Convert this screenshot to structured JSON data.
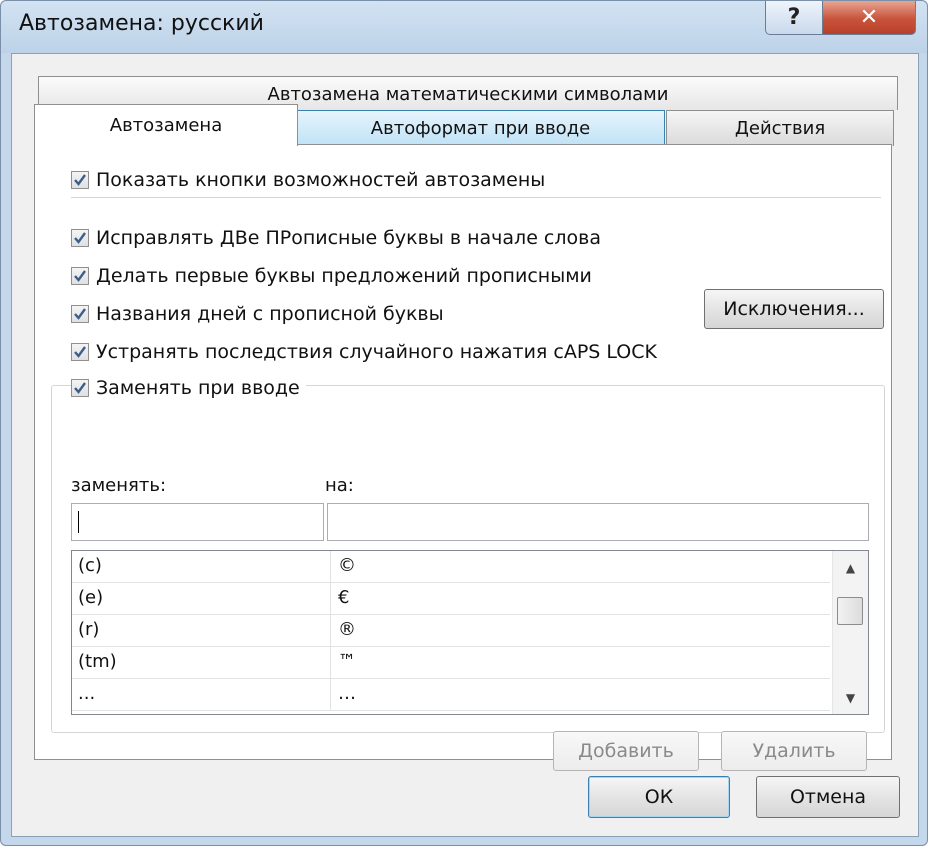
{
  "window": {
    "title": "Автозамена: русский",
    "help_label": "?",
    "close_label": "✕"
  },
  "tabs": {
    "math": "Автозамена математическими символами",
    "autocorrect": "Автозамена",
    "autoformat": "Автоформат при вводе",
    "actions": "Действия"
  },
  "options": {
    "show_buttons": "Показать кнопки возможностей автозамены",
    "two_initial_caps": "Исправлять ДВе ПРописные буквы в начале слова",
    "capitalize_sentences": "Делать первые буквы предложений прописными",
    "capitalize_days": "Названия дней с прописной буквы",
    "caps_lock": "Устранять последствия случайного нажатия cAPS LOCK",
    "replace_as_type": "Заменять при вводе"
  },
  "exceptions_label": "Исключения...",
  "replace": {
    "replace_label": "заменять:",
    "with_label": "на:",
    "replace_value": "",
    "with_value": ""
  },
  "entries": [
    {
      "from": "(c)",
      "to": "©"
    },
    {
      "from": "(e)",
      "to": "€"
    },
    {
      "from": "(r)",
      "to": "®"
    },
    {
      "from": "(tm)",
      "to": "™"
    },
    {
      "from": "...",
      "to": "…"
    }
  ],
  "buttons": {
    "add": "Добавить",
    "delete": "Удалить",
    "ok": "ОК",
    "cancel": "Отмена"
  },
  "colors": {
    "title_bar": "#c4d7eb",
    "close_button": "#c8533a",
    "active_tab_hover": "#bfe2f6"
  }
}
